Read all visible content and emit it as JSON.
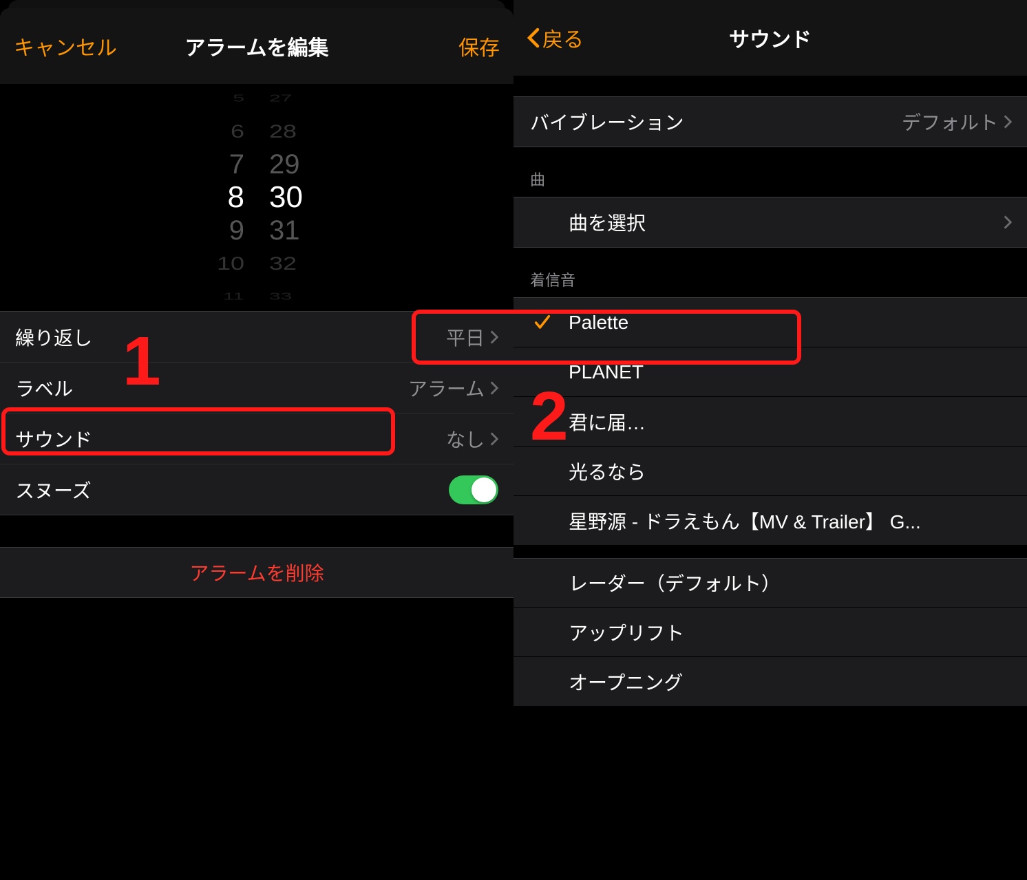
{
  "left": {
    "cancel": "キャンセル",
    "title": "アラームを編集",
    "save": "保存",
    "picker": {
      "hours": [
        "5",
        "6",
        "7",
        "8",
        "9",
        "10",
        "11"
      ],
      "mins": [
        "27",
        "28",
        "29",
        "30",
        "31",
        "32",
        "33"
      ]
    },
    "rows": {
      "repeat_label": "繰り返し",
      "repeat_value": "平日",
      "label_label": "ラベル",
      "label_value": "アラーム",
      "sound_label": "サウンド",
      "sound_value": "なし",
      "snooze_label": "スヌーズ"
    },
    "delete": "アラームを削除"
  },
  "right": {
    "back": "戻る",
    "title": "サウンド",
    "vibration_label": "バイブレーション",
    "vibration_value": "デフォルト",
    "section_song": "曲",
    "choose_song": "曲を選択",
    "section_ringtone": "着信音",
    "items": [
      "Palette",
      "PLANET",
      "君に届…",
      "光るなら",
      "星野源 - ドラえもん【MV & Trailer】 G...",
      "レーダー（デフォルト）",
      "アップリフト",
      "オープニング"
    ]
  },
  "annotations": {
    "n1": "1",
    "n2": "2"
  }
}
